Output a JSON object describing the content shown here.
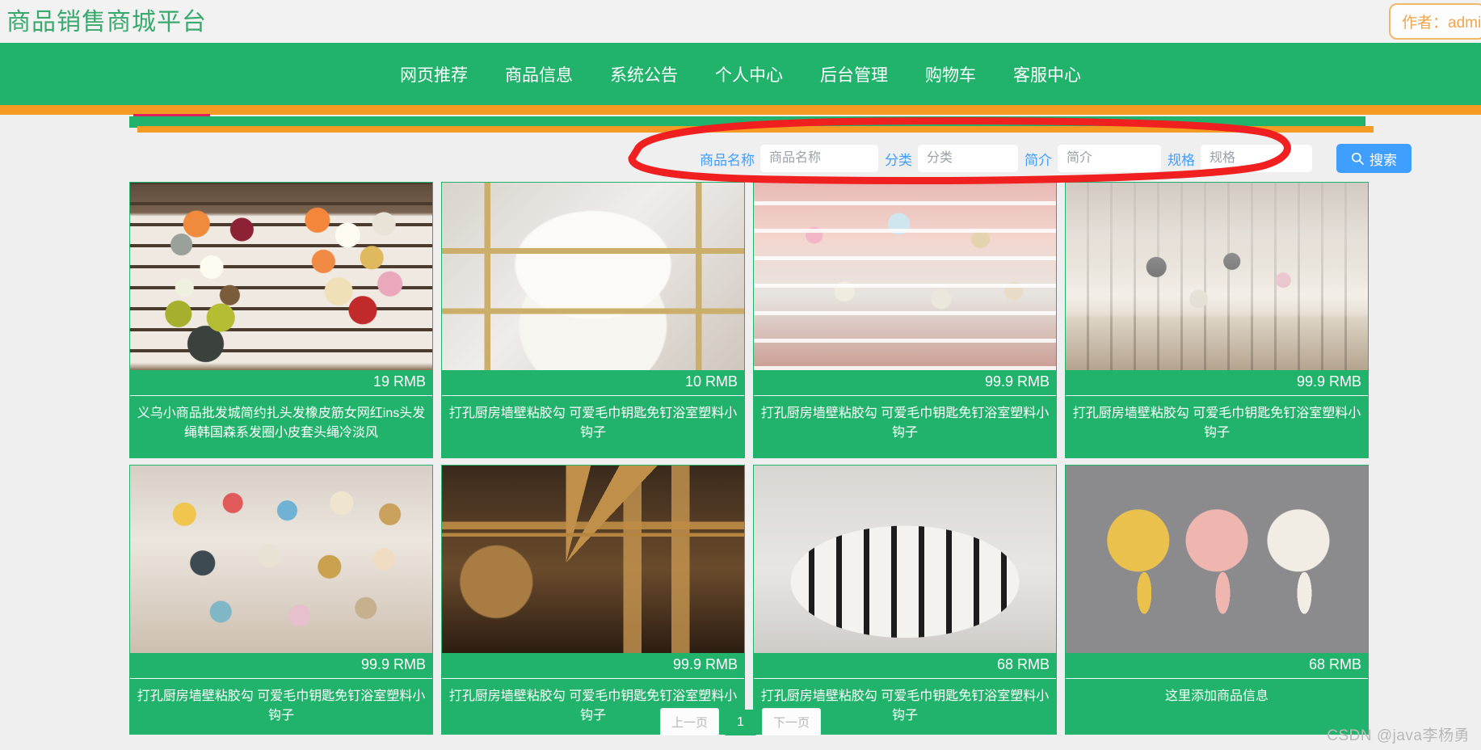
{
  "header": {
    "site_title": "商品销售商城平台",
    "author_badge": "作者：admi"
  },
  "nav": {
    "items": [
      {
        "label": "网页推荐"
      },
      {
        "label": "商品信息"
      },
      {
        "label": "系统公告"
      },
      {
        "label": "个人中心"
      },
      {
        "label": "后台管理"
      },
      {
        "label": "购物车"
      },
      {
        "label": "客服中心"
      }
    ]
  },
  "search": {
    "fields": [
      {
        "label": "商品名称",
        "placeholder": "商品名称",
        "value": ""
      },
      {
        "label": "分类",
        "placeholder": "分类",
        "value": ""
      },
      {
        "label": "简介",
        "placeholder": "简介",
        "value": ""
      },
      {
        "label": "规格",
        "placeholder": "规格",
        "value": ""
      }
    ],
    "button_label": "搜索",
    "button_icon": "search-icon"
  },
  "products": [
    {
      "price": "19 RMB",
      "title": "义乌小商品批发城简约扎头发橡皮筋女网红ins头发绳韩国森系发圈小皮套头绳冷淡风",
      "image": "hair-ties-display-board"
    },
    {
      "price": "10 RMB",
      "title": "打孔厨房墙壁粘胶勾 可爱毛巾钥匙免钉浴室塑料小钩子",
      "image": "gold-two-tier-tray"
    },
    {
      "price": "99.9 RMB",
      "title": "打孔厨房墙壁粘胶勾 可爱毛巾钥匙免钉浴室塑料小钩子",
      "image": "pearl-hair-clips-set"
    },
    {
      "price": "99.9 RMB",
      "title": "打孔厨房墙壁粘胶勾 可爱毛巾钥匙免钉浴室塑料小钩子",
      "image": "hand-holding-clip-pack"
    },
    {
      "price": "99.9 RMB",
      "title": "打孔厨房墙壁粘胶勾 可爱毛巾钥匙免钉浴室塑料小钩子",
      "image": "assorted-hairpins-in-hand"
    },
    {
      "price": "99.9 RMB",
      "title": "打孔厨房墙壁粘胶勾 可爱毛巾钥匙免钉浴室塑料小钩子",
      "image": "landmark-metal-models"
    },
    {
      "price": "68 RMB",
      "title": "打孔厨房墙壁粘胶勾 可爱毛巾钥匙免钉浴室塑料小钩子",
      "image": "checkered-tote-bag"
    },
    {
      "price": "68 RMB",
      "title": "这里添加商品信息",
      "image": "wall-hooks-three-colors"
    }
  ],
  "pagination": {
    "prev_label": "上一页",
    "current_page": "1",
    "next_label": "下一页"
  },
  "watermark": {
    "text": "CSDN @java李杨勇"
  },
  "colors": {
    "brand_green": "#21b36b",
    "stripe_orange": "#f59a23",
    "stripe_pink": "#e0215c",
    "accent_blue": "#409eff",
    "author_orange": "#f0a64c",
    "annotation_red": "#f02020"
  }
}
